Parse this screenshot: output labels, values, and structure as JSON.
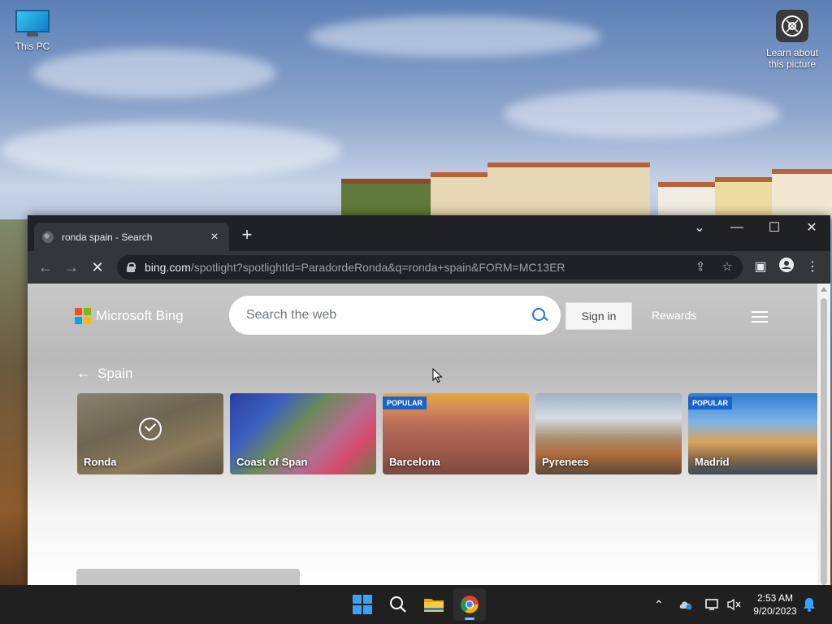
{
  "desktop": {
    "icons": [
      {
        "label": "This PC",
        "icon": "monitor-icon"
      },
      {
        "label": "Learn about\nthis picture",
        "icon": "camera-icon"
      }
    ]
  },
  "browser": {
    "tab": {
      "title": "ronda spain - Search"
    },
    "url": {
      "host": "bing.com",
      "path": "/spotlight?spotlightId=ParadordeRonda&q=ronda+spain&FORM=MC13ER"
    }
  },
  "bing": {
    "brand": "Microsoft Bing",
    "search_placeholder": "Search the web",
    "signin_label": "Sign in",
    "rewards_label": "Rewards",
    "back_label": "Spain",
    "cards": [
      {
        "label": "Ronda",
        "badge": "",
        "selected": true
      },
      {
        "label": "Coast of Span",
        "badge": "",
        "selected": false
      },
      {
        "label": "Barcelona",
        "badge": "POPULAR",
        "selected": false
      },
      {
        "label": "Pyrenees",
        "badge": "",
        "selected": false
      },
      {
        "label": "Madrid",
        "badge": "POPULAR",
        "selected": false
      }
    ]
  },
  "taskbar": {
    "apps": [
      "windows-start-icon",
      "search-icon",
      "file-explorer-icon",
      "chrome-icon"
    ],
    "time": "2:53 AM",
    "date": "9/20/2023"
  },
  "colors": {
    "chrome_dark": "#202124",
    "chrome_toolbar": "#35363a",
    "bing_blue": "#1a73e8",
    "badge_blue": "#1a63c8",
    "taskbar": "#202020"
  }
}
